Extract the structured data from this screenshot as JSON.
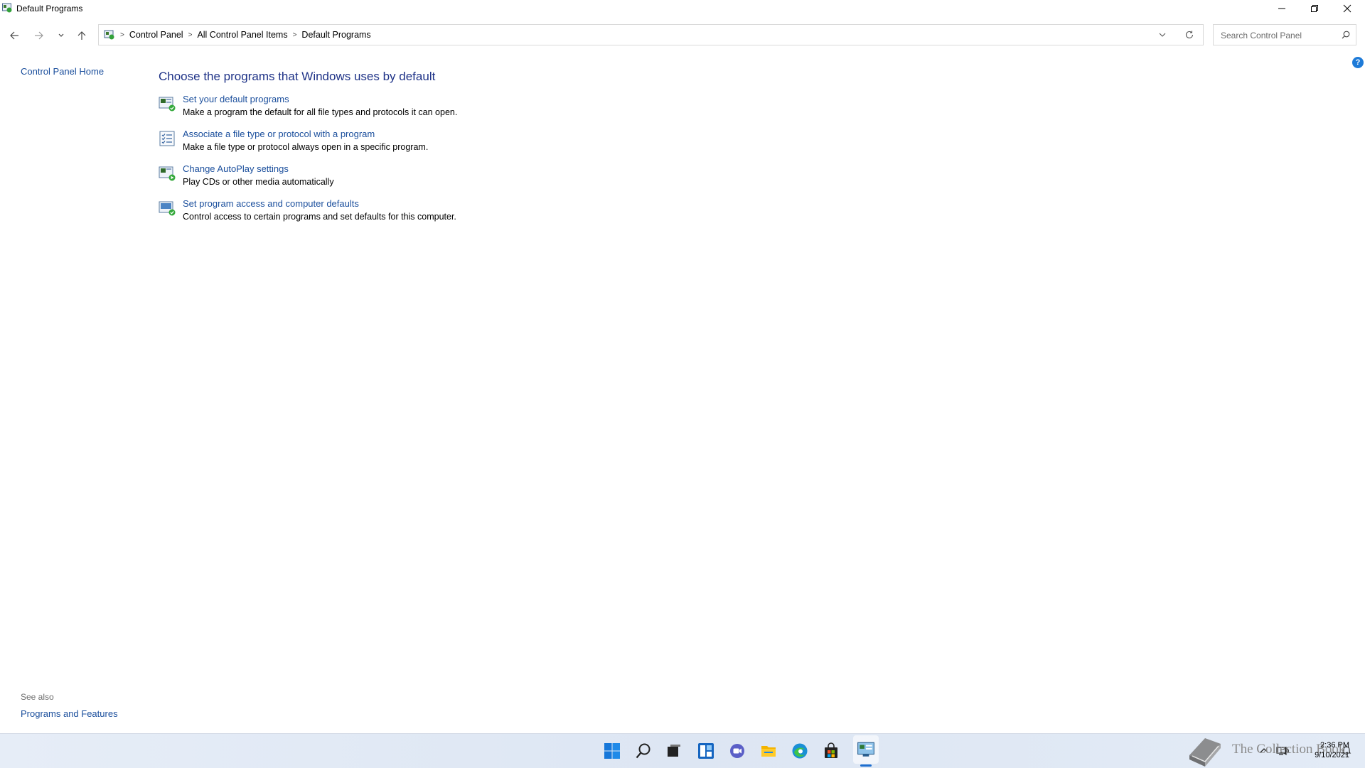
{
  "window": {
    "title": "Default Programs",
    "buttons": [
      "minimize-icon",
      "restore-icon",
      "close-icon"
    ]
  },
  "address_bar": {
    "breadcrumbs": [
      "Control Panel",
      "All Control Panel Items",
      "Default Programs"
    ]
  },
  "search": {
    "placeholder": "Search Control Panel"
  },
  "sidebar": {
    "home_link": "Control Panel Home",
    "see_also_label": "See also",
    "see_also_links": [
      "Programs and Features"
    ]
  },
  "main": {
    "heading": "Choose the programs that Windows uses by default",
    "items": [
      {
        "title": "Set your default programs",
        "description": "Make a program the default for all file types and protocols it can open.",
        "icon": "default-programs-icon"
      },
      {
        "title": "Associate a file type or protocol with a program",
        "description": "Make a file type or protocol always open in a specific program.",
        "icon": "file-association-icon"
      },
      {
        "title": "Change AutoPlay settings",
        "description": "Play CDs or other media automatically",
        "icon": "autoplay-icon"
      },
      {
        "title": "Set program access and computer defaults",
        "description": "Control access to certain programs and set defaults for this computer.",
        "icon": "program-access-icon"
      }
    ]
  },
  "taskbar": {
    "apps": [
      "windows-start-icon",
      "search-icon",
      "task-view-icon",
      "widgets-icon",
      "chat-icon",
      "file-explorer-icon",
      "edge-icon",
      "store-icon",
      "control-panel-icon"
    ],
    "watermark": "The Collection Book",
    "clock_time": "2:36 PM",
    "clock_date": "9/10/2021"
  },
  "colors": {
    "link": "#1a4e9c",
    "heading": "#1e3287",
    "accent": "#1e6ecf"
  }
}
